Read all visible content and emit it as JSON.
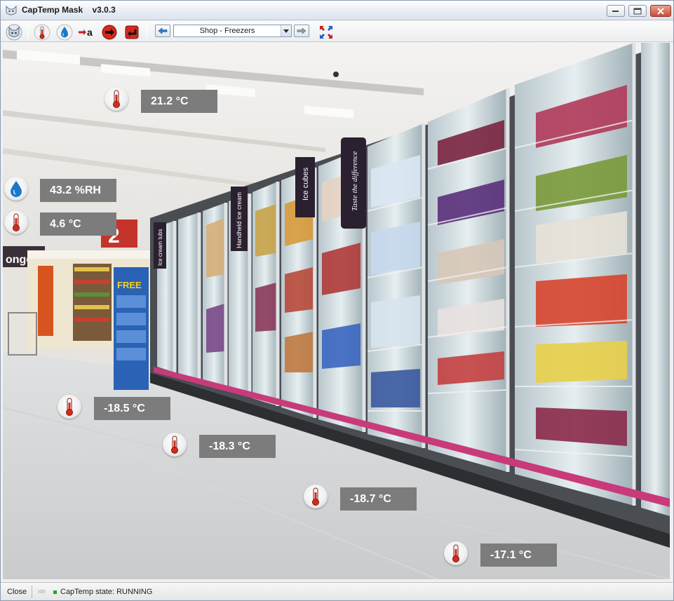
{
  "window": {
    "title": "CapTemp Mask    v3.0.3"
  },
  "toolbar": {
    "icons": [
      "cat-logo-icon",
      "thermometer-icon",
      "humidity-drop-icon",
      "arrow-a-icon",
      "exit-red-icon",
      "return-red-icon"
    ],
    "location_select": {
      "value": "Shop - Freezers"
    }
  },
  "sensors": [
    {
      "type": "temperature",
      "value": "21.2 °C"
    },
    {
      "type": "humidity",
      "value": "43.2 %RH"
    },
    {
      "type": "temperature",
      "value": "4.6 °C"
    },
    {
      "type": "temperature",
      "value": "-18.5 °C"
    },
    {
      "type": "temperature",
      "value": "-18.3 °C"
    },
    {
      "type": "temperature",
      "value": "-18.7 °C"
    },
    {
      "type": "temperature",
      "value": "-17.1 °C"
    }
  ],
  "scene_signs": {
    "tubs": "Ice cream tubs",
    "handheld": "Handheld ice cream",
    "cubes": "Ice cubes",
    "taste": "Taste the difference",
    "promo": "FREE",
    "store": "onger",
    "bignum": "2"
  },
  "statusbar": {
    "close_label": "Close",
    "chevrons": "»»",
    "state_text": "CapTemp state: RUNNING"
  },
  "colors": {
    "label_bg": "#7c7c7c",
    "label_text": "#ffffff",
    "thermometer_red": "#d42a1c",
    "drop_blue": "#1a78c8",
    "status_green": "#22a822"
  }
}
